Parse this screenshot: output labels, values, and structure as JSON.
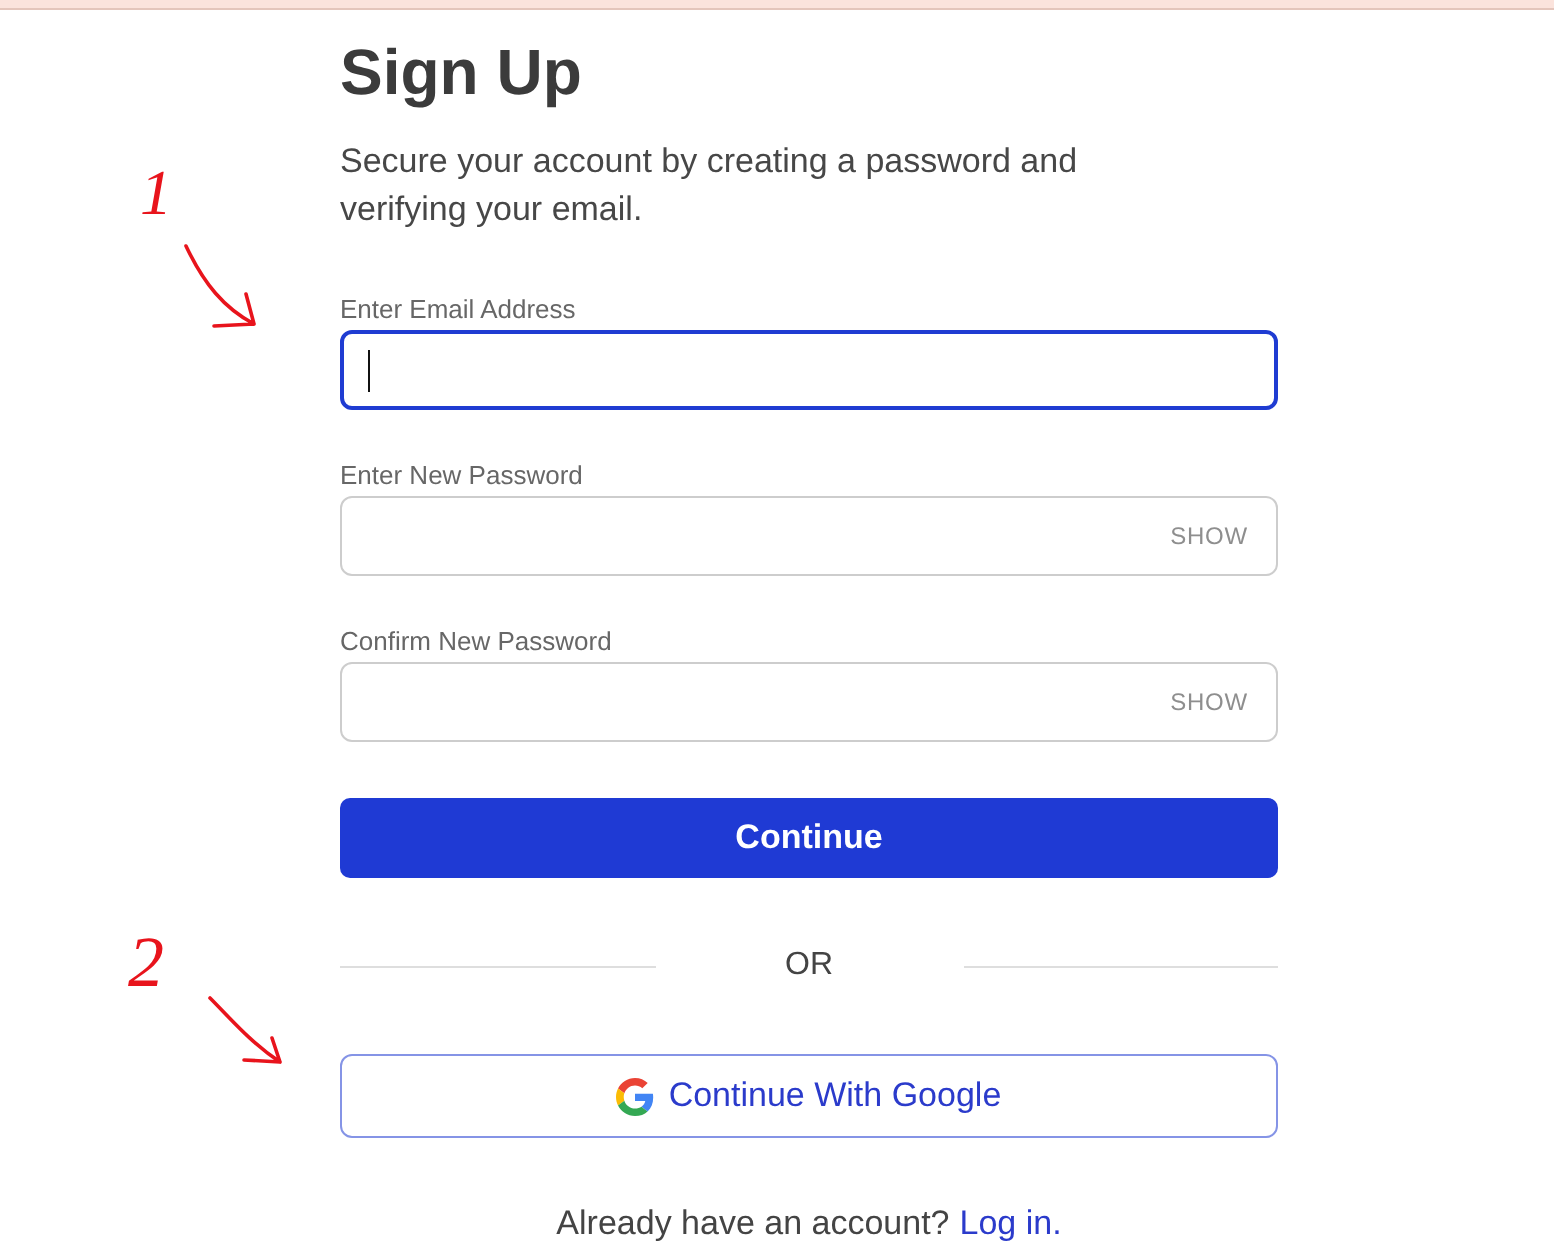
{
  "title": "Sign Up",
  "subtitle": "Secure your account by creating a password and verifying your email.",
  "fields": [
    {
      "label": "Enter Email Address",
      "kind": "email",
      "focused": true
    },
    {
      "label": "Enter New Password",
      "kind": "password",
      "focused": false,
      "toggle": "SHOW"
    },
    {
      "label": "Confirm New Password",
      "kind": "password",
      "focused": false,
      "toggle": "SHOW"
    }
  ],
  "continue_button": "Continue",
  "divider": "OR",
  "google_button": "Continue With Google",
  "login_prompt": {
    "text": "Already have an account?",
    "link": "Log in."
  },
  "annotations": [
    {
      "label": "1"
    },
    {
      "label": "2"
    }
  ]
}
